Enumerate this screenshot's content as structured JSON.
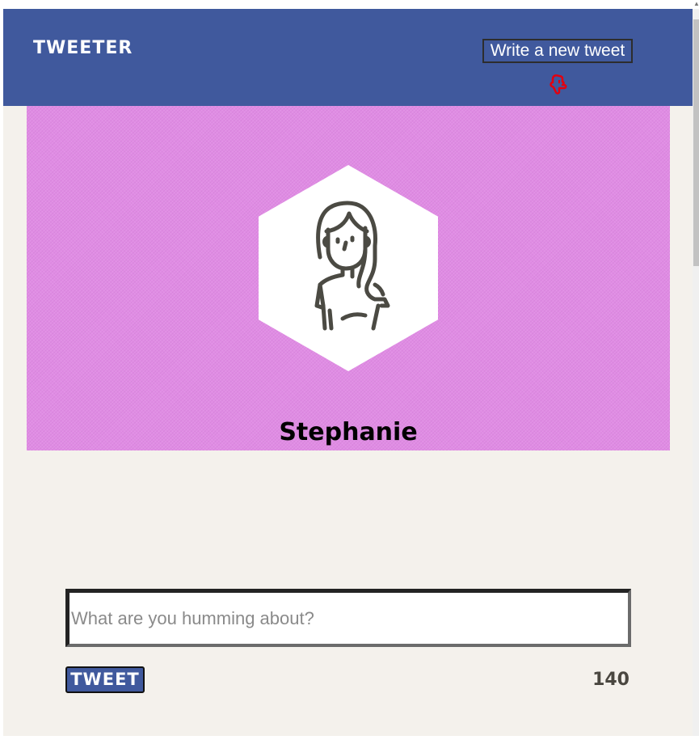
{
  "header": {
    "brand": "TWEETER",
    "compose_toggle_label": "Write a new tweet"
  },
  "profile": {
    "name": "Stephanie",
    "background_color": "#e08ce4"
  },
  "compose": {
    "placeholder": "What are you humming about?",
    "submit_label": "TWEET",
    "char_counter": "140"
  },
  "icons": {
    "pointer": "pointing-hand-icon",
    "avatar": "avatar-woman-icon"
  },
  "colors": {
    "nav_background": "#40599d",
    "page_background": "#f4f1ec",
    "pointer_icon": "#e3000f"
  }
}
